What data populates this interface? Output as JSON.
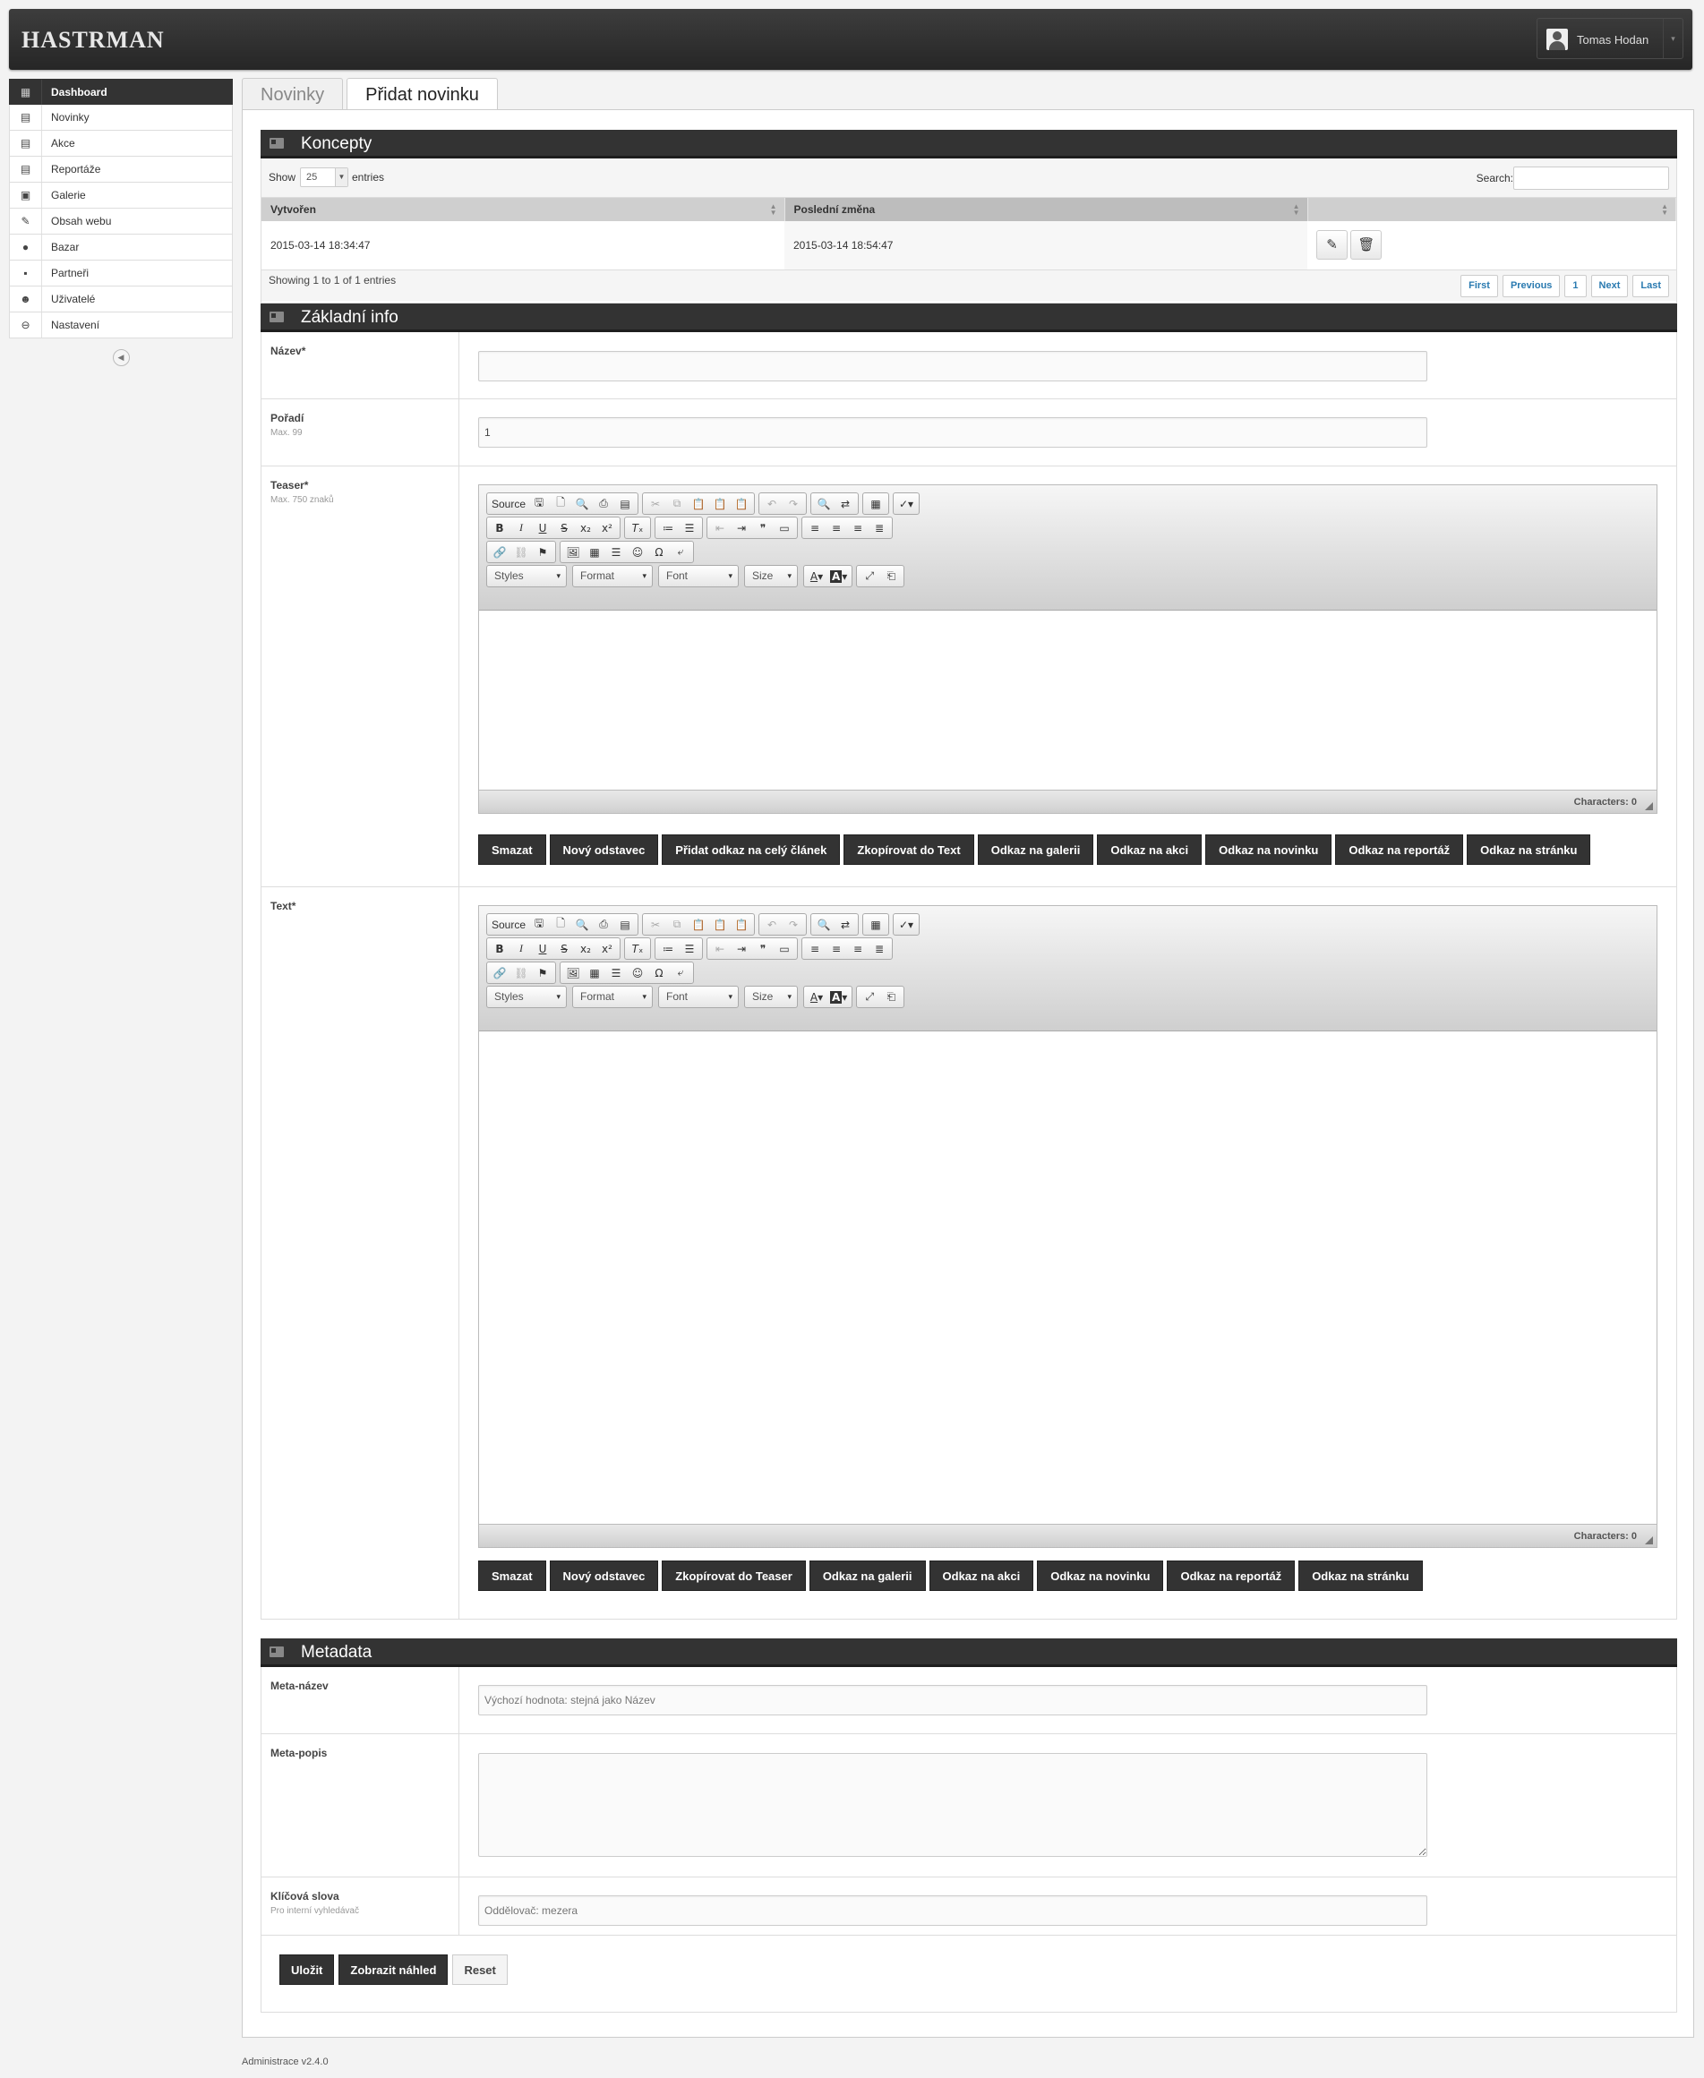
{
  "header": {
    "logo": "HASTRMAN",
    "user_name": "Tomas Hodan"
  },
  "sidebar": {
    "items": [
      {
        "label": "Dashboard",
        "icon": "dashboard-icon",
        "glyph": "▦"
      },
      {
        "label": "Novinky",
        "icon": "news-icon",
        "glyph": "▤"
      },
      {
        "label": "Akce",
        "icon": "events-icon",
        "glyph": "▤"
      },
      {
        "label": "Reportáže",
        "icon": "reports-icon",
        "glyph": "▤"
      },
      {
        "label": "Galerie",
        "icon": "gallery-icon",
        "glyph": "▣"
      },
      {
        "label": "Obsah webu",
        "icon": "pencil-icon",
        "glyph": "✎"
      },
      {
        "label": "Bazar",
        "icon": "chat-icon",
        "glyph": "●"
      },
      {
        "label": "Partneři",
        "icon": "partners-icon",
        "glyph": "▪"
      },
      {
        "label": "Uživatelé",
        "icon": "users-icon",
        "glyph": "☻"
      },
      {
        "label": "Nastavení",
        "icon": "settings-icon",
        "glyph": "⊖"
      }
    ]
  },
  "tabs": [
    {
      "label": "Novinky"
    },
    {
      "label": "Přidat novinku"
    }
  ],
  "concepts": {
    "title": "Koncepty",
    "show_label": "Show",
    "page_length": "25",
    "entries_label": "entries",
    "search_label": "Search:",
    "columns": [
      "Vytvořen",
      "Poslední změna",
      ""
    ],
    "rows": [
      {
        "created": "2015-03-14 18:34:47",
        "modified": "2015-03-14 18:54:47"
      }
    ],
    "info": "Showing 1 to 1 of 1 entries",
    "pager": [
      "First",
      "Previous",
      "1",
      "Next",
      "Last"
    ]
  },
  "basic": {
    "title": "Základní info",
    "name_label": "Název*",
    "name_value": "",
    "order_label": "Pořadí",
    "order_hint": "Max. 99",
    "order_value": "1",
    "teaser_label": "Teaser*",
    "teaser_hint": "Max. 750 znaků",
    "text_label": "Text*"
  },
  "editor": {
    "source": "Source",
    "styles": "Styles",
    "format": "Format",
    "font": "Font",
    "size": "Size",
    "chars": "Characters: 0"
  },
  "teaser_snippets": [
    "Smazat",
    "Nový odstavec",
    "Přidat odkaz na celý článek",
    "Zkopírovat do Text",
    "Odkaz na galerii",
    "Odkaz na akci",
    "Odkaz na novinku",
    "Odkaz na reportáž",
    "Odkaz na stránku"
  ],
  "text_snippets": [
    "Smazat",
    "Nový odstavec",
    "Zkopírovat do Teaser",
    "Odkaz na galerii",
    "Odkaz na akci",
    "Odkaz na novinku",
    "Odkaz na reportáž",
    "Odkaz na stránku"
  ],
  "metadata": {
    "title": "Metadata",
    "meta_name_label": "Meta-název",
    "meta_name_placeholder": "Výchozí hodnota: stejná jako Název",
    "meta_desc_label": "Meta-popis",
    "keywords_label": "Klíčová slova",
    "keywords_hint": "Pro interní vyhledávač",
    "keywords_placeholder": "Oddělovač: mezera"
  },
  "actions": {
    "save": "Uložit",
    "preview": "Zobrazit náhled",
    "reset": "Reset"
  },
  "footer": "Administrace v2.4.0"
}
